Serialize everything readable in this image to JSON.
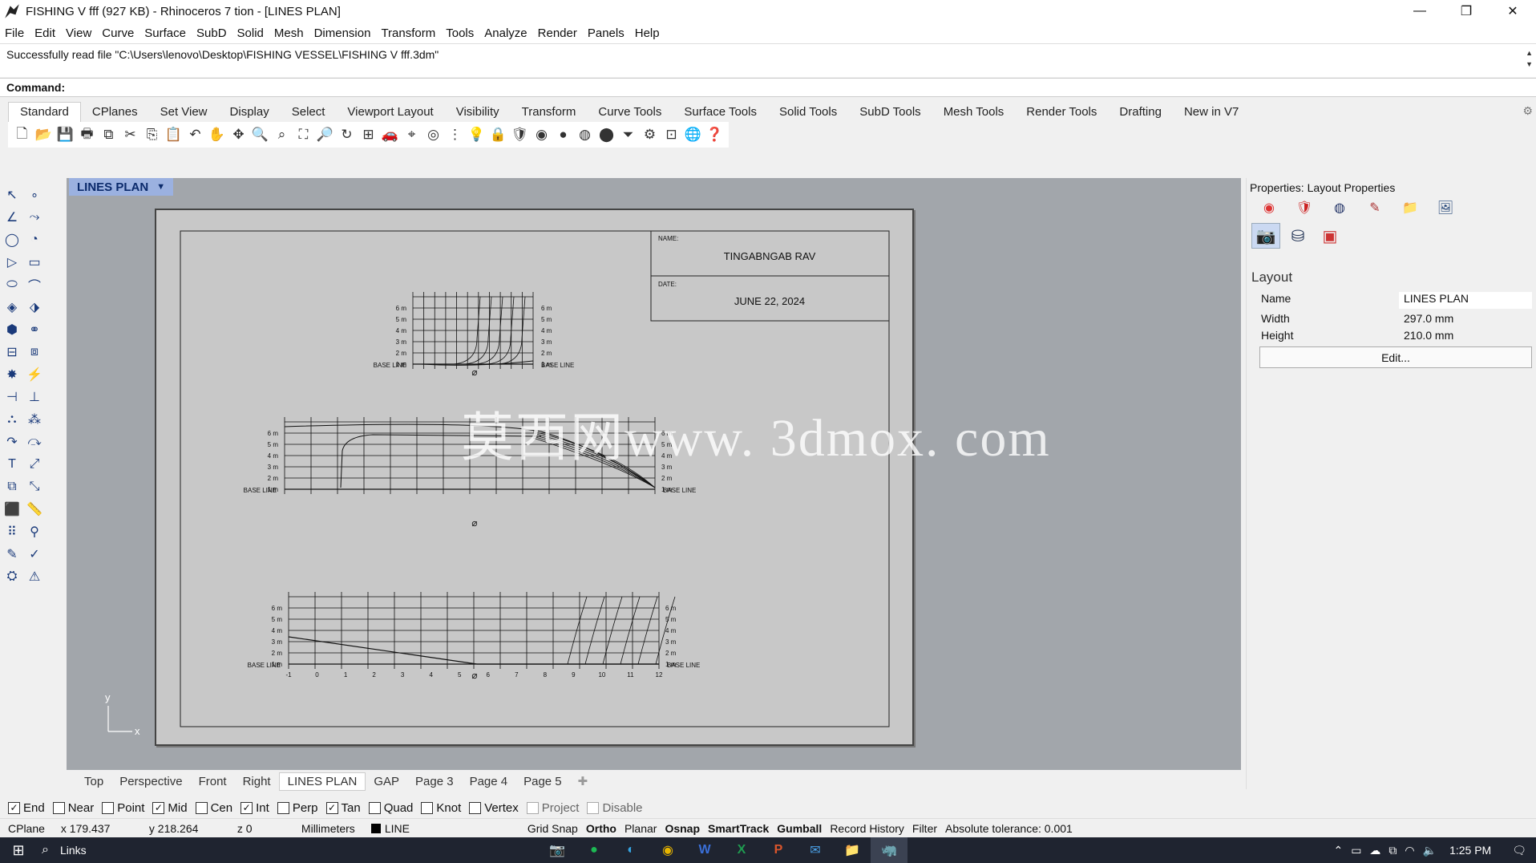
{
  "window": {
    "title": "FISHING V fff (927 KB) - Rhinoceros 7 tion - [LINES PLAN]",
    "minimize": "—",
    "maximize": "❐",
    "close": "✕"
  },
  "menu": [
    "File",
    "Edit",
    "View",
    "Curve",
    "Surface",
    "SubD",
    "Solid",
    "Mesh",
    "Dimension",
    "Transform",
    "Tools",
    "Analyze",
    "Render",
    "Panels",
    "Help"
  ],
  "command_history": "Successfully read file \"C:\\Users\\lenovo\\Desktop\\FISHING VESSEL\\FISHING V fff.3dm\"",
  "command_prompt": "Command:",
  "toolbar_tabs": [
    "Standard",
    "CPlanes",
    "Set View",
    "Display",
    "Select",
    "Viewport Layout",
    "Visibility",
    "Transform",
    "Curve Tools",
    "Surface Tools",
    "Solid Tools",
    "SubD Tools",
    "Mesh Tools",
    "Render Tools",
    "Drafting",
    "New in V7"
  ],
  "active_toolbar_tab": "Standard",
  "viewport": {
    "title": "LINES PLAN",
    "watermark": "莫西网www. 3dmox. com"
  },
  "titleblock": {
    "name_label": "NAME:",
    "name_value": "TINGABNGAB RAV",
    "date_label": "DATE:",
    "date_value": "JUNE 22, 2024"
  },
  "drawing": {
    "level_labels": [
      "6 m",
      "5 m",
      "4 m",
      "3 m",
      "2 m",
      "1 m"
    ],
    "base_line": "BASE LINE",
    "midship_symbol": "⌀",
    "station_labels": [
      "-1",
      "0",
      "1",
      "2",
      "3",
      "4",
      "5",
      "6",
      "7",
      "8",
      "9",
      "10",
      "11",
      "12"
    ],
    "axis_y": "y",
    "axis_x": "x"
  },
  "viewport_tabs": [
    "Top",
    "Perspective",
    "Front",
    "Right",
    "LINES PLAN",
    "GAP",
    "Page 3",
    "Page 4",
    "Page 5"
  ],
  "active_viewport_tab": "LINES PLAN",
  "properties": {
    "title": "Properties: Layout Properties",
    "section": "Layout",
    "name_label": "Name",
    "name_value": "LINES PLAN",
    "width_label": "Width",
    "width_value": "297.0 mm",
    "height_label": "Height",
    "height_value": "210.0 mm",
    "edit_button": "Edit..."
  },
  "osnaps": [
    {
      "label": "End",
      "checked": true
    },
    {
      "label": "Near",
      "checked": false
    },
    {
      "label": "Point",
      "checked": false
    },
    {
      "label": "Mid",
      "checked": true
    },
    {
      "label": "Cen",
      "checked": false
    },
    {
      "label": "Int",
      "checked": true
    },
    {
      "label": "Perp",
      "checked": false
    },
    {
      "label": "Tan",
      "checked": true
    },
    {
      "label": "Quad",
      "checked": false
    },
    {
      "label": "Knot",
      "checked": false
    },
    {
      "label": "Vertex",
      "checked": false
    },
    {
      "label": "Project",
      "checked": false,
      "disabled": true
    },
    {
      "label": "Disable",
      "checked": false,
      "disabled": true
    }
  ],
  "status": {
    "cplane": "CPlane",
    "x": "x 179.437",
    "y": "y 218.264",
    "z": "z 0",
    "units": "Millimeters",
    "layer": "LINE",
    "grid_snap": "Grid Snap",
    "ortho": "Ortho",
    "planar": "Planar",
    "osnap": "Osnap",
    "smarttrack": "SmartTrack",
    "gumball": "Gumball",
    "record_history": "Record History",
    "filter": "Filter",
    "tolerance": "Absolute tolerance: 0.001"
  },
  "taskbar": {
    "search": "Links",
    "time": "1:25 PM"
  }
}
